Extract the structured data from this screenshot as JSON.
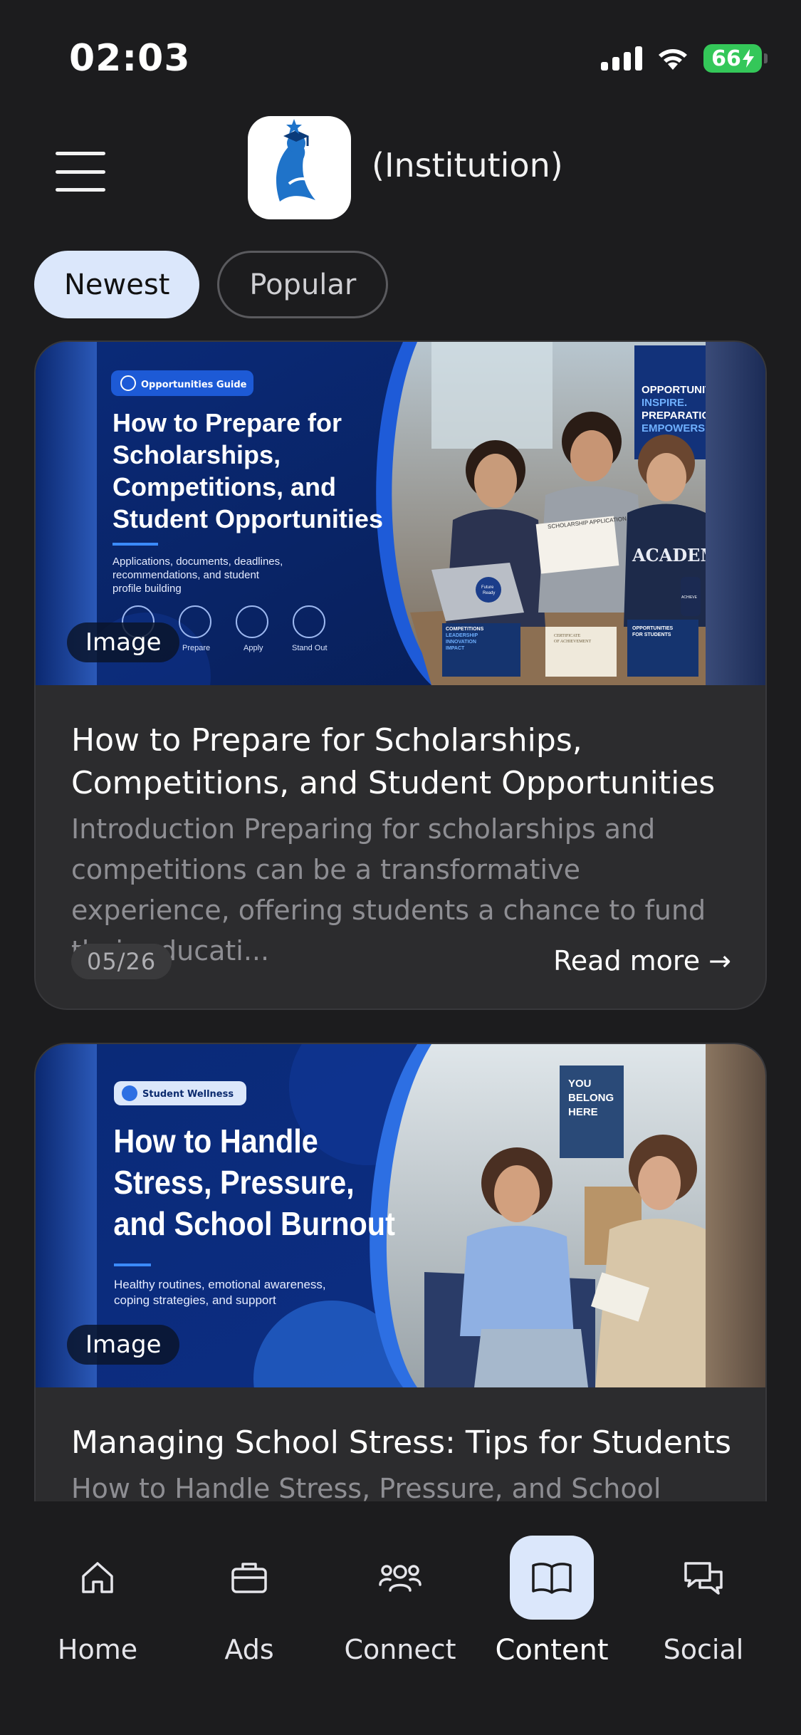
{
  "status_bar": {
    "time": "02:03",
    "battery": "66",
    "icons": [
      "cellular-signal-icon",
      "wifi-icon",
      "battery-charging-icon"
    ]
  },
  "header": {
    "menu_icon": "hamburger-menu-icon",
    "app_name": "(Institution)"
  },
  "tabs": [
    {
      "label": "Newest",
      "active": true
    },
    {
      "label": "Popular",
      "active": false
    }
  ],
  "posts": [
    {
      "image_badge": "Image",
      "banner": {
        "tag": "Opportunities Guide",
        "headline": [
          "How to Prepare for",
          "Scholarships,",
          "Competitions, and",
          "Student Opportunities"
        ],
        "subline": [
          "Applications, documents, deadlines,",
          "recommendations, and student",
          "profile building"
        ],
        "steps": [
          "Prepare",
          "Apply",
          "Stand Out"
        ],
        "poster": [
          "OPPORTUNITIES",
          "INSPIRE.",
          "PREPARATION",
          "EMPOWERS."
        ],
        "sweatshirt": "ACADEMY",
        "paper": "SCHOLARSHIP APPLICATION",
        "sticker": [
          "Future",
          "Ready"
        ],
        "booklet_left": [
          "COMPETITIONS",
          "LEADERSHIP",
          "INNOVATION",
          "IMPACT"
        ],
        "booklet_mid": [
          "CERTIFICATE",
          "OF ACHIEVEMENT"
        ],
        "booklet_right": [
          "OPPORTUNITIES",
          "FOR STUDENTS"
        ],
        "cup": "ACHIEVE"
      },
      "title": "How to Prepare for Scholarships, Competitions, and Student Opportunities",
      "excerpt": "Introduction Preparing for scholarships and competitions can be a transformative experience, offering students a chance to fund their educati...",
      "date": "05/26",
      "read_more": "Read more →"
    },
    {
      "image_badge": "Image",
      "banner": {
        "tag": "Student Wellness",
        "headline": [
          "How to Handle",
          "Stress, Pressure,",
          "and School Burnout"
        ],
        "subline": [
          "Healthy routines, emotional awareness,",
          "coping strategies, and support"
        ],
        "poster": [
          "YOU",
          "BELONG",
          "HERE"
        ]
      },
      "title": "Managing School Stress: Tips for Students",
      "excerpt": "How to Handle Stress, Pressure, and School"
    }
  ],
  "bottom_nav": [
    {
      "label": "Home",
      "icon": "home-icon",
      "active": false
    },
    {
      "label": "Ads",
      "icon": "briefcase-icon",
      "active": false
    },
    {
      "label": "Connect",
      "icon": "people-icon",
      "active": false
    },
    {
      "label": "Content",
      "icon": "open-book-icon",
      "active": true
    },
    {
      "label": "Social",
      "icon": "chat-bubbles-icon",
      "active": false
    }
  ],
  "colors": {
    "background": "#1c1c1e",
    "card": "#2c2c2e",
    "accent_light": "#dbe7fb",
    "banner_navy": "#0a2a78",
    "banner_blue": "#1e5bd8",
    "battery_green": "#34c759"
  }
}
